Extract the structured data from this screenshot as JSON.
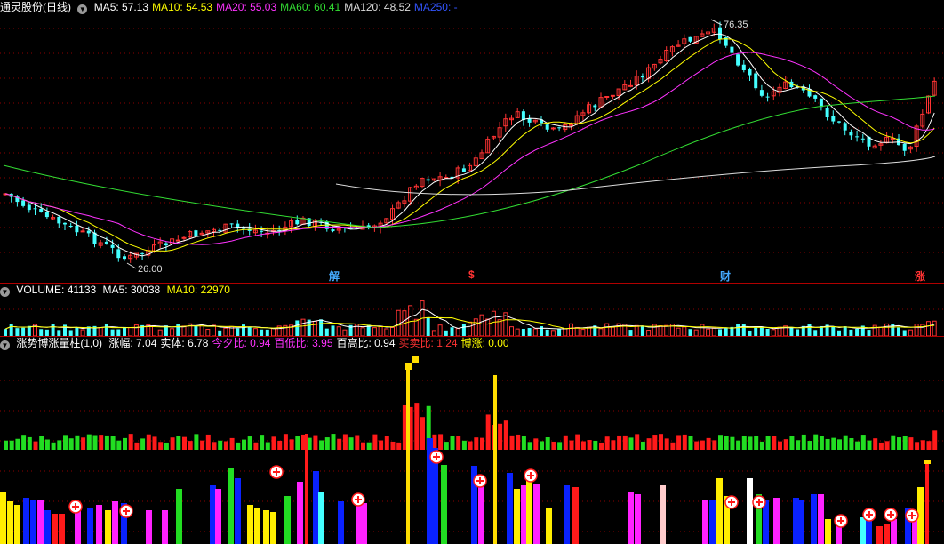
{
  "price_panel": {
    "stock_title": "通灵股份(日线)",
    "indicators": [
      {
        "label": "MA5: 57.13",
        "color": "#ffffff"
      },
      {
        "label": "MA10: 54.53",
        "color": "#ffff00"
      },
      {
        "label": "MA20: 55.03",
        "color": "#ff33ff"
      },
      {
        "label": "MA60: 60.41",
        "color": "#33dd33"
      },
      {
        "label": "MA120: 48.52",
        "color": "#dddddd"
      },
      {
        "label": "MA250: -",
        "color": "#3355ff"
      }
    ],
    "high_label": "76.35",
    "low_label": "26.00",
    "events": [
      {
        "text": "解",
        "color": "#44aaff"
      },
      {
        "text": "$",
        "color": "#ff3333"
      },
      {
        "text": "财",
        "color": "#44aaff"
      },
      {
        "text": "涨",
        "color": "#ff3333"
      }
    ]
  },
  "volume_panel": {
    "title": "VOLUME: 41133",
    "ma5": "MA5: 30038",
    "ma10": "MA10: 22970"
  },
  "indicator_panel": {
    "title": "涨势博涨量柱(1,0)",
    "items": [
      {
        "label": "涨幅: 7.04",
        "color": "#ffffff"
      },
      {
        "label": "实体: 6.78",
        "color": "#ffffff"
      },
      {
        "label": "今夕比: 0.94",
        "color": "#ff33ff"
      },
      {
        "label": "百低比: 3.95",
        "color": "#ff33ff"
      },
      {
        "label": "百高比: 0.94",
        "color": "#ffffff"
      },
      {
        "label": "买卖比: 1.24",
        "color": "#ff3333"
      },
      {
        "label": "博涨: 0.00",
        "color": "#ffff00"
      }
    ]
  },
  "colors": {
    "up": "#ff3333",
    "down": "#44ffff",
    "grid": "#8b0000"
  }
}
